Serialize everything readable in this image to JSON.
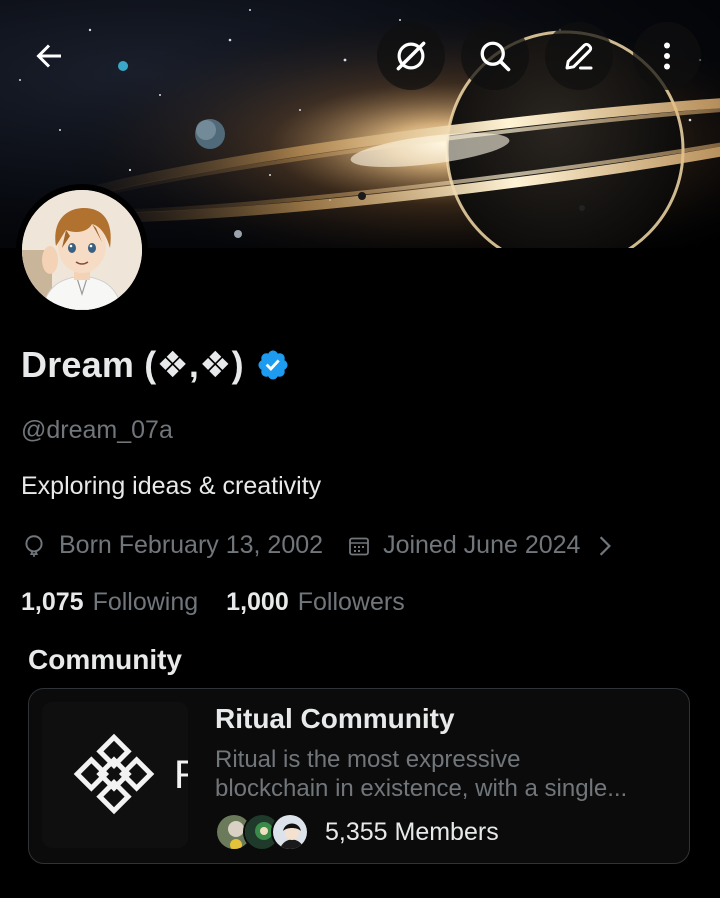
{
  "topbar": {
    "icons": [
      "back-arrow-icon",
      "grok-icon",
      "search-icon",
      "edit-icon",
      "more-vertical-icon"
    ]
  },
  "profile": {
    "name": "Dream (❖,❖)",
    "verified": true,
    "handle": "@dream_07a",
    "bio": "Exploring ideas & creativity",
    "born": "Born February 13, 2002",
    "joined": "Joined June 2024",
    "following_count": "1,075",
    "following_label": "Following",
    "followers_count": "1,000",
    "followers_label": "Followers"
  },
  "community_section": {
    "title": "Community",
    "card": {
      "name": "Ritual Community",
      "description_line1": "Ritual is the most expressive",
      "description_line2": "blockchain in existence, with a single...",
      "members": "5,355 Members",
      "thumb_glyph": "R"
    }
  },
  "colors": {
    "background": "#000000",
    "text_primary": "#e7e9ea",
    "text_secondary": "#71767b",
    "verified_blue": "#1d9bf0",
    "card_border": "#2f3336"
  }
}
